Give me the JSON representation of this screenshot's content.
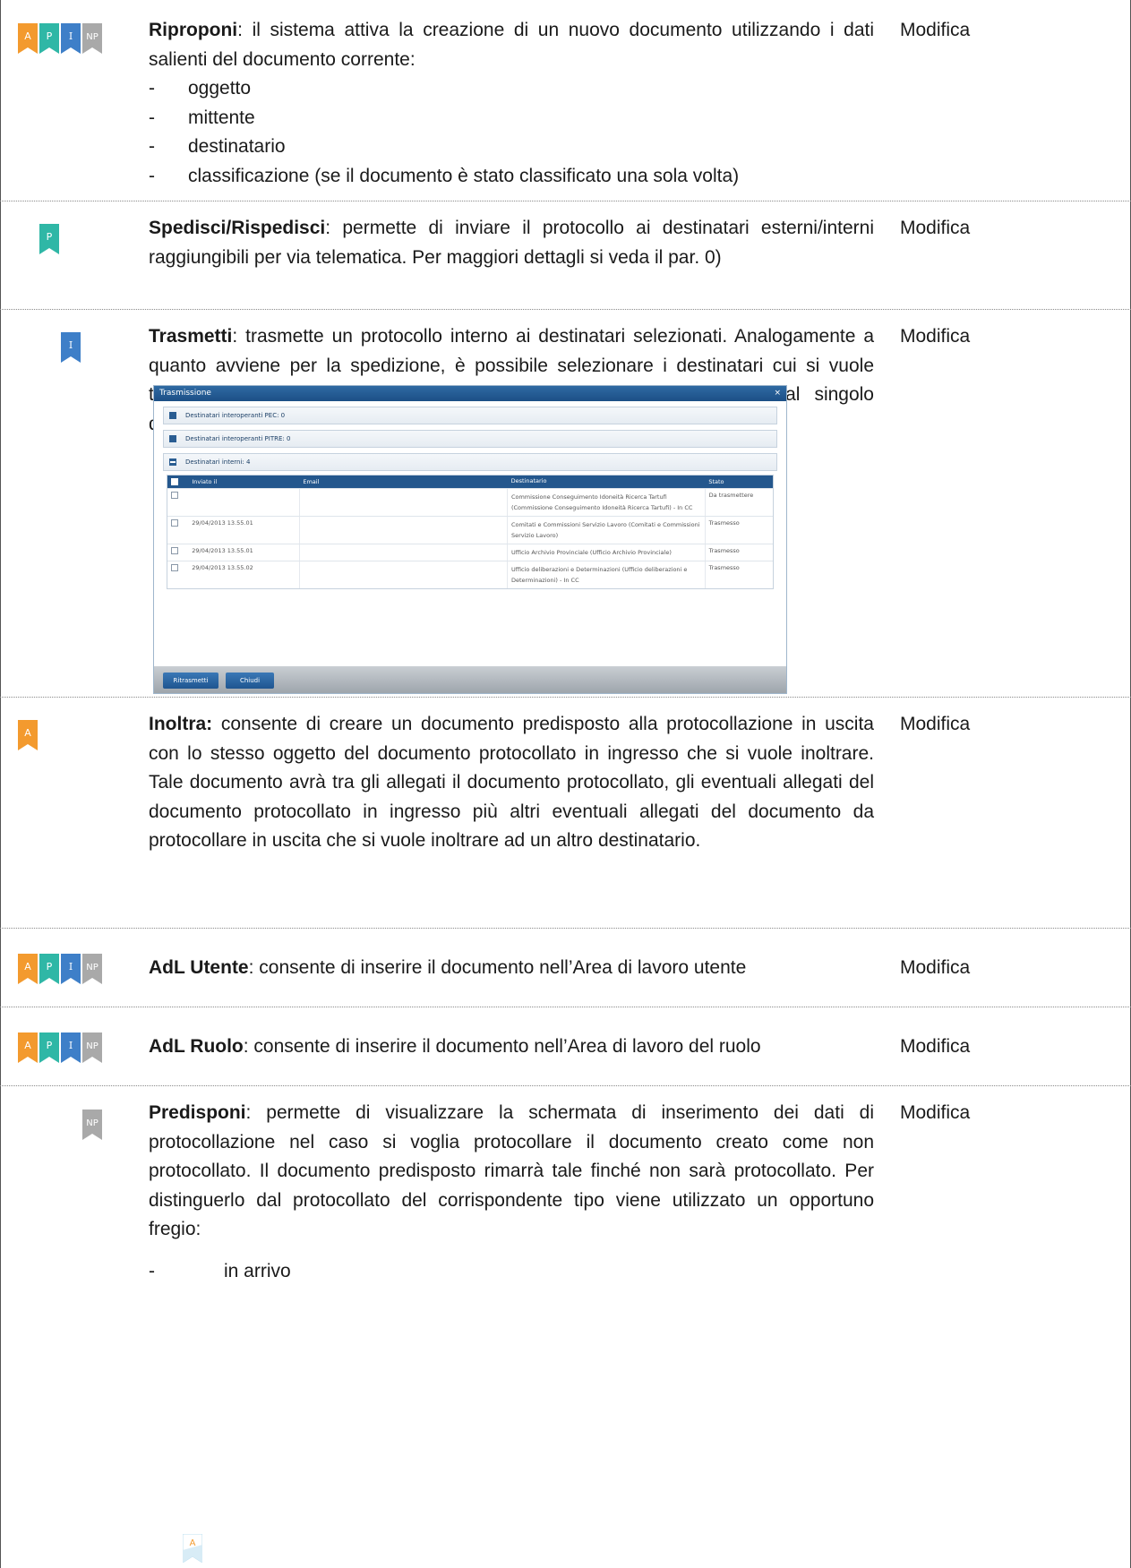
{
  "rows": [
    {
      "id": "riproponi",
      "badges": [
        "A",
        "P",
        "I",
        "NP"
      ],
      "title": "Riproponi",
      "text": ": il sistema attiva la creazione di un nuovo documento utilizzando i dati salienti del documento corrente:",
      "bullets": [
        "oggetto",
        "mittente",
        "destinatario",
        "classificazione (se il documento è stato classificato una sola volta)"
      ],
      "action": "Modifica"
    },
    {
      "id": "spedisci",
      "badges": [
        "P"
      ],
      "title": "Spedisci/Rispedisci",
      "text": ": permette di inviare il protocollo ai destinatari esterni/interni raggiungibili per via telematica. Per maggiori dettagli si veda il par. 0)",
      "action": "Modifica"
    },
    {
      "id": "trasmetti",
      "badges": [
        "I"
      ],
      "title": "Trasmetti",
      "text": ": trasmette un protocollo interno ai destinatari selezionati. Analogamente a quanto avviene per la spedizione, è possibile selezionare i destinatari cui si vuole trasmettere. Una volta effettuata la trasmissione lo stato associato al singolo destinatario diventerà Trasmesso. e verrà mostrata data/ora di trasmissione.",
      "action": "Modifica"
    },
    {
      "id": "inoltra",
      "badges": [
        "A"
      ],
      "title": "Inoltra:",
      "text": " consente di creare un documento predisposto alla protocollazione in uscita con lo stesso oggetto del documento protocollato in ingresso che si vuole inoltrare. Tale documento avrà tra gli allegati il documento protocollato, gli eventuali allegati del documento protocollato in ingresso più altri eventuali allegati del documento da protocollare in uscita che si vuole inoltrare ad un altro destinatario.",
      "action": "Modifica"
    },
    {
      "id": "adl-utente",
      "badges": [
        "A",
        "P",
        "I",
        "NP"
      ],
      "title": "AdL Utente",
      "text": ": consente di inserire il documento nell’Area di lavoro utente",
      "action": "Modifica"
    },
    {
      "id": "adl-ruolo",
      "badges": [
        "A",
        "P",
        "I",
        "NP"
      ],
      "title": "AdL Ruolo",
      "text": ": consente di inserire il documento nell’Area di lavoro del ruolo",
      "action": "Modifica"
    },
    {
      "id": "predisponi",
      "badges": [
        "NP"
      ],
      "title": "Predisponi",
      "text": ": permette di visualizzare la schermata di inserimento dei dati di protocollazione nel caso si voglia protocollare il documento creato come non protocollato. Il documento predisposto rimarrà tale finché non sarà protocollato. Per distinguerlo dal protocollato del corrispondente tipo viene utilizzato un opportuno fregio:",
      "bullets": [
        "in arrivo"
      ],
      "fregio": "A",
      "action": "Modifica"
    }
  ],
  "badge_colors": {
    "A": "#f39a2e",
    "P": "#2fb7a6",
    "I": "#3e7fc8",
    "NP": "#a9a9a9"
  },
  "dialog": {
    "title": "Trasmissione",
    "close": "×",
    "sections": [
      "Destinatari interoperanti PEC: 0",
      "Destinatari interoperanti PITRE: 0",
      "Destinatari interni: 4"
    ],
    "columns": [
      "Inviato il",
      "Email",
      "Destinatario",
      "Stato"
    ],
    "table": [
      {
        "inviato": "",
        "email": "",
        "destinatario": "Commissione Conseguimento Idoneità Ricerca Tartufi (Commissione Conseguimento Idoneità Ricerca Tartufi) - In CC",
        "stato": "Da trasmettere"
      },
      {
        "inviato": "29/04/2013 13.55.01",
        "email": "",
        "destinatario": "Comitati e Commissioni Servizio Lavoro (Comitati e Commissioni Servizio Lavoro)",
        "stato": "Trasmesso"
      },
      {
        "inviato": "29/04/2013 13.55.01",
        "email": "",
        "destinatario": "Ufficio Archivio Provinciale (Ufficio Archivio Provinciale)",
        "stato": "Trasmesso"
      },
      {
        "inviato": "29/04/2013 13.55.02",
        "email": "",
        "destinatario": "Ufficio deliberazioni e Determinazioni (Ufficio deliberazioni e Determinazioni) - In CC",
        "stato": "Trasmesso"
      }
    ],
    "buttons": [
      "Ritrasmetti",
      "Chiudi"
    ]
  }
}
